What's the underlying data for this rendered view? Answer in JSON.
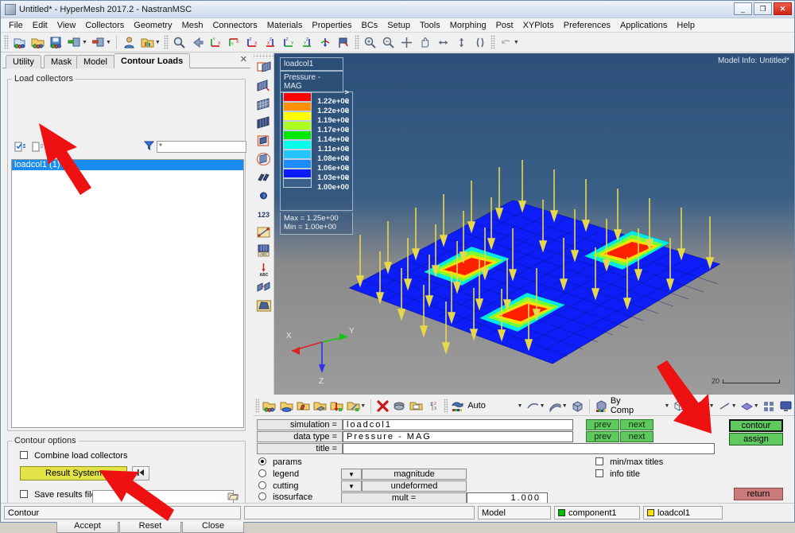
{
  "window": {
    "title": "Untitled* - HyperMesh 2017.2 - NastranMSC",
    "minimize": "_",
    "maximize": "❐",
    "close": "✕"
  },
  "menu": [
    "File",
    "Edit",
    "View",
    "Collectors",
    "Geometry",
    "Mesh",
    "Connectors",
    "Materials",
    "Properties",
    "BCs",
    "Setup",
    "Tools",
    "Morphing",
    "Post",
    "XYPlots",
    "Preferences",
    "Applications",
    "Help"
  ],
  "toolbar": {
    "icons": [
      "new-model-icon",
      "open-model-icon",
      "save-model-icon",
      "import-icon",
      "export-icon",
      "user-profile-icon",
      "load-userprofile-icon",
      "zoom-find-icon",
      "back-view-icon",
      "xy-view-icon",
      "yx-view-icon",
      "xz-view-icon",
      "zx-view-icon",
      "zy-view-icon",
      "yz-view-icon",
      "iso-view-icon",
      "flag-view-icon",
      "zoom-in-icon",
      "zoom-out-icon",
      "fit-view-icon",
      "pan-icon",
      "rotate-horizontal-icon",
      "rotate-vertical-icon",
      "rotate-free-icon",
      "undo-icon"
    ]
  },
  "left_panel": {
    "tabs": [
      {
        "label": "Utility",
        "active": false
      },
      {
        "label": "Mask",
        "active": false
      },
      {
        "label": "Model",
        "active": false
      },
      {
        "label": "Contour Loads",
        "active": true
      }
    ],
    "close_label": "✕",
    "load_collectors": {
      "group_label": "Load collectors",
      "tool_icons": [
        "select-all-icon",
        "select-none-icon",
        "reverse-selection-icon"
      ],
      "filter_icon": "filter-icon",
      "filter_value": "*",
      "items": [
        {
          "label": "loadcol1 (1)",
          "selected": true
        }
      ]
    },
    "contour_options": {
      "group_label": "Contour options",
      "combine_label": "Combine load collectors",
      "combine_checked": false,
      "result_system_label": "Result System",
      "result_system_reset_icon": "rewind-icon",
      "save_results_label": "Save results file",
      "save_results_checked": false,
      "save_results_path": "",
      "folder_icon": "open-folder-icon"
    },
    "buttons": {
      "accept": "Accept",
      "reset": "Reset",
      "close": "Close"
    }
  },
  "vertical_toolbar": {
    "icons": [
      "shaded-elements-and-mesh-lines-icon",
      "shaded-elements-arrow-icon",
      "wireframe-mesh-icon",
      "shaded-mesh-icon",
      "hidden-line-icon",
      "transparency-icon",
      "mesh-lines-icon",
      "node-icon",
      "numbers-icon",
      "measure-icon",
      "element-color-icon",
      "abc-tag-icon",
      "abc-note-icon",
      "visualization-icon",
      "view-box-icon"
    ]
  },
  "graphics": {
    "model_info": "Model Info: Untitled*",
    "header_lines": [
      "loadcol1",
      "Pressure - MAG"
    ],
    "legend": {
      "entries": [
        {
          "color": "#ff0000",
          "label": "> 1.22e+00"
        },
        {
          "color": "#ff9000",
          "label": "< 1.22e+00"
        },
        {
          "color": "#ffff00",
          "label": "< 1.19e+00"
        },
        {
          "color": "#adff22",
          "label": "< 1.17e+00"
        },
        {
          "color": "#00e800",
          "label": "< 1.14e+00"
        },
        {
          "color": "#00ffe8",
          "label": "< 1.11e+00"
        },
        {
          "color": "#25c6ff",
          "label": "< 1.08e+00"
        },
        {
          "color": "#1b8bff",
          "label": "< 1.06e+00"
        },
        {
          "color": "#0b1bff",
          "label": "< 1.03e+00"
        },
        {
          "color": "#3b5f88",
          "label": "< 1.00e+00"
        }
      ],
      "max": "Max = 1.25e+00",
      "min": "Min = 1.00e+00"
    },
    "axis_triad": {
      "x": "X",
      "y": "Y",
      "z": "Z"
    },
    "scale_value": "20"
  },
  "command_toolbar": {
    "icons": [
      "component-collector-icon",
      "property-collector-icon",
      "material-collector-icon",
      "assembly-collector-icon",
      "load-collector-icon",
      "system-collector-icon",
      "delete-icon",
      "organize-icon",
      "card-edit-icon",
      "renumber-icon",
      "color-auto-icon",
      "shaded-geometry-icon",
      "shaded-surface-icon",
      "shaded-solid-icon",
      "bycomp-icon",
      "mesh-lines-wire-icon",
      "solid-mesh-icon",
      "line-display-icon",
      "surface-display-icon",
      "element-display-icon",
      "screen-capture-icon"
    ],
    "color_mode": "Auto",
    "display_mode": "By Comp"
  },
  "command_panel": {
    "fields": [
      {
        "label": "simulation =",
        "value": "loadcol1",
        "prev": "prev",
        "next": "next"
      },
      {
        "label": "data type =",
        "value": "Pressure - MAG",
        "prev": "prev",
        "next": "next"
      },
      {
        "label": "title     =",
        "value": ""
      }
    ],
    "radios": [
      {
        "label": "params",
        "selected": true
      },
      {
        "label": "legend",
        "selected": false
      },
      {
        "label": "cutting",
        "selected": false
      },
      {
        "label": "isosurface",
        "selected": false
      }
    ],
    "dropdowns": [
      {
        "label": "magnitude"
      },
      {
        "label": "undeformed"
      }
    ],
    "mult": {
      "label": "mult     =",
      "value": "1.000"
    },
    "checkboxes": [
      {
        "label": "min/max titles",
        "checked": false
      },
      {
        "label": "info title",
        "checked": false
      }
    ],
    "action_buttons": [
      {
        "label": "contour",
        "selected": true
      },
      {
        "label": "assign",
        "selected": false
      }
    ],
    "return_button": "return"
  },
  "statusbar": {
    "message": "Contour",
    "cells": [
      {
        "label": "",
        "swatch": null
      },
      {
        "label": "Model",
        "swatch": null
      },
      {
        "label": "component1",
        "swatch": "#00c000"
      },
      {
        "label": "loadcol1",
        "swatch": "#ffe000"
      }
    ]
  }
}
